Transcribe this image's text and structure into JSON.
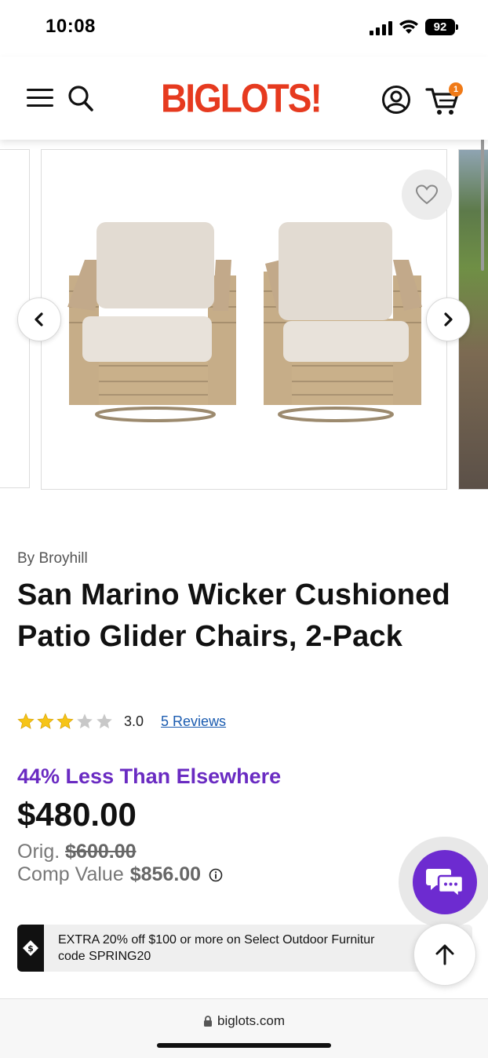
{
  "status_bar": {
    "time": "10:08",
    "battery": "92"
  },
  "header": {
    "logo_big": "BIG",
    "logo_lots": "LOTS!",
    "cart_count": "1"
  },
  "product": {
    "brand": "By Broyhill",
    "title": "San Marino Wicker Cushioned Patio Glider Chairs, 2-Pack",
    "rating": 3.0,
    "rating_text": "3.0",
    "reviews_link": "5 Reviews",
    "stars_filled": 3,
    "stars_total": 5
  },
  "pricing": {
    "savings": "44% Less Than Elsewhere",
    "price": "$480.00",
    "orig_label": "Orig.",
    "orig_price": "$600.00",
    "comp_label": "Comp Value",
    "comp_value": "$856.00"
  },
  "promo": {
    "line1": "EXTRA 20% off $100 or more on Select Outdoor Furnitur",
    "line2": "code SPRING20"
  },
  "browser": {
    "url": "biglots.com"
  },
  "colors": {
    "brand_red": "#e63a1f",
    "savings_purple": "#6a2bc2",
    "chat_purple": "#6d2bd0",
    "badge_orange": "#f07a17",
    "link_blue": "#1a5bb0"
  },
  "icons": [
    "menu-icon",
    "search-icon",
    "account-icon",
    "cart-icon",
    "heart-icon",
    "chevron-left-icon",
    "chevron-right-icon",
    "star-icon",
    "info-icon",
    "price-tag-icon",
    "chat-icon",
    "arrow-up-icon",
    "lock-icon"
  ]
}
